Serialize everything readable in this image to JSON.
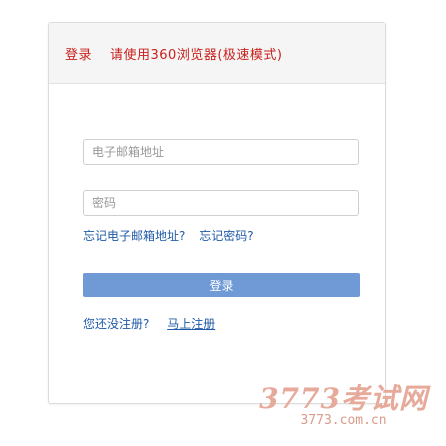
{
  "header": {
    "title": "登录",
    "note": "请使用360浏览器(极速模式)",
    "accent_color": "#c8201c"
  },
  "form": {
    "email_placeholder": "电子邮箱地址",
    "email_value": "",
    "password_placeholder": "密码",
    "password_value": "",
    "forgot_email": "忘记电子邮箱地址?",
    "forgot_password": "忘记密码?",
    "login_button": "登录",
    "button_color": "#6f9ad6"
  },
  "register": {
    "question": "您还没注册?",
    "link": "马上注册"
  },
  "watermark": {
    "main": "3773考试网",
    "domain": "3773.com.cn"
  }
}
